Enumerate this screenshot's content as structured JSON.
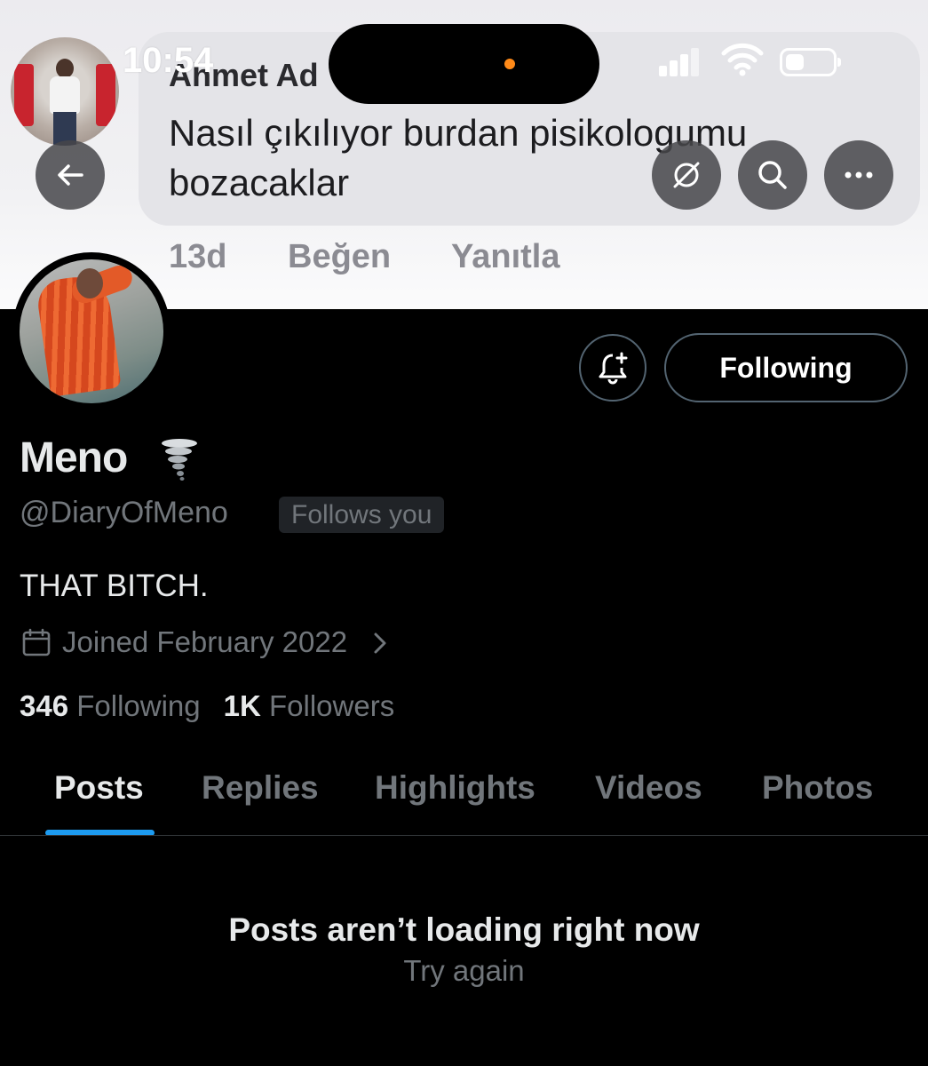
{
  "status_bar": {
    "time": "10:54"
  },
  "banner_comment": {
    "author": "Ahmet Ad",
    "text": "Nasıl çıkılıyor burdan pisikologumu bozacaklar",
    "age": "13d",
    "like_label": "Beğen",
    "reply_label": "Yanıtla"
  },
  "header_buttons": [
    "back-icon",
    "mute-icon",
    "search-icon",
    "more-icon"
  ],
  "profile": {
    "name": "Meno",
    "name_emoji": "tornado-icon",
    "handle": "@DiaryOfMeno",
    "follows_you": "Follows you",
    "bio": "THAT BITCH.",
    "joined": "Joined February 2022",
    "following_count": "346",
    "following_label": "Following",
    "followers_count": "1K",
    "followers_label": "Followers"
  },
  "actions": {
    "follow_label": "Following",
    "notify_icon": "bell-plus-icon"
  },
  "tabs": [
    {
      "label": "Posts",
      "active": true
    },
    {
      "label": "Replies"
    },
    {
      "label": "Highlights"
    },
    {
      "label": "Videos"
    },
    {
      "label": "Photos"
    }
  ],
  "feed_error": {
    "title": "Posts aren’t loading right now",
    "retry": "Try again"
  },
  "colors": {
    "accent": "#1d9bf0",
    "background": "#000000",
    "text": "#e7e9ea",
    "muted": "#71767b",
    "live_dot": "#ff8a18"
  }
}
